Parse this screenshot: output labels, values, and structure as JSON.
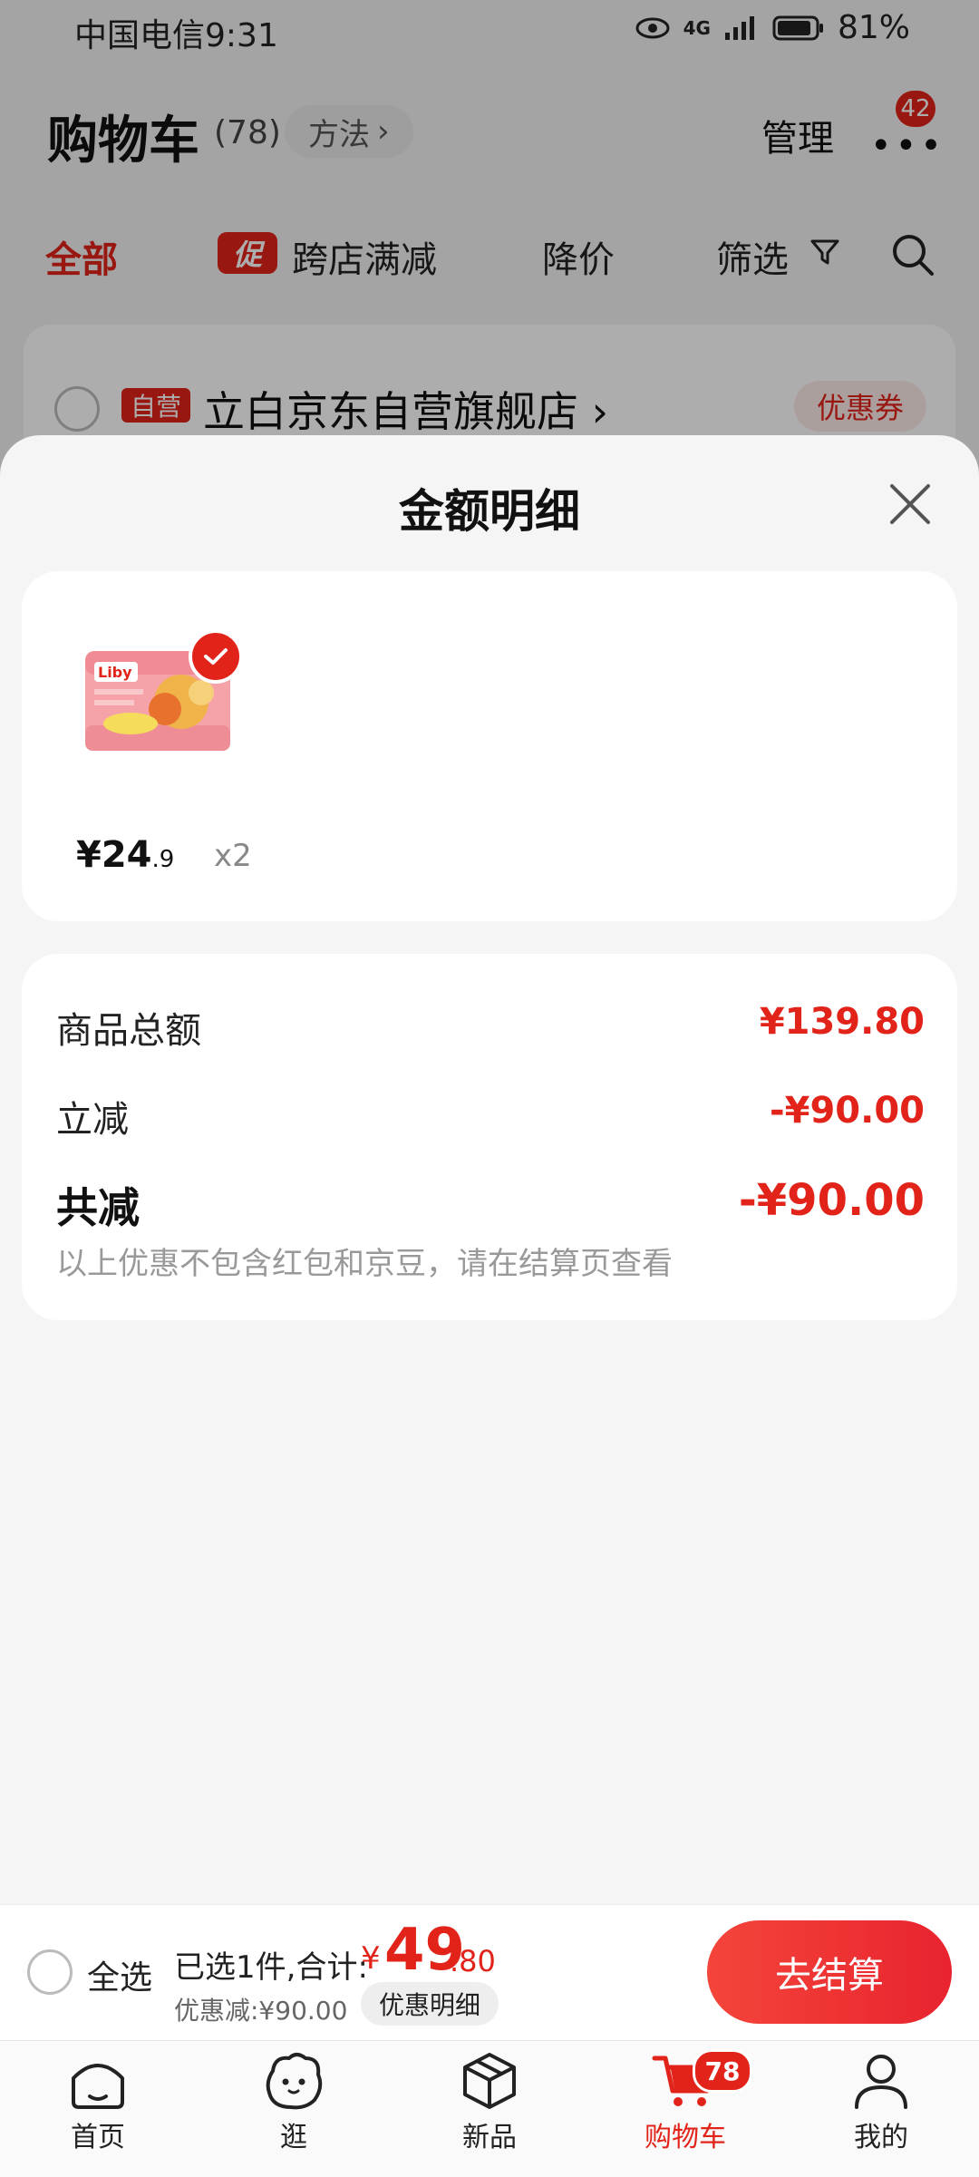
{
  "status_bar": {
    "carrier_time": "中国电信9:31",
    "network": "4G",
    "battery": "81%"
  },
  "cart_header": {
    "title": "购物车",
    "count": "(78)",
    "method_label": "方法",
    "manage_label": "管理",
    "message_badge": "42"
  },
  "filters": {
    "all": "全部",
    "promo_tag": "促",
    "cross_store": "跨店满减",
    "price_drop": "降价",
    "screen": "筛选"
  },
  "store": {
    "self_tag": "自营",
    "name": "立白京东自营旗舰店 ›",
    "coupon": "优惠券"
  },
  "sheet": {
    "title": "金额明细",
    "product": {
      "price_main": "¥24",
      "price_decimal": ".9",
      "quantity": "x2"
    },
    "rows": [
      {
        "label": "商品总额",
        "value": "¥139.80"
      },
      {
        "label": "立减",
        "value": "-¥90.00"
      }
    ],
    "total_label": "共减",
    "total_value": "-¥90.00",
    "note": "以上优惠不包含红包和京豆，请在结算页查看"
  },
  "checkout": {
    "select_all": "全选",
    "selected_text": "已选1件,合计:",
    "currency": "¥",
    "total_int": "49",
    "total_dec": ".80",
    "discount_text": "优惠减:¥90.00",
    "detail_chip": "优惠明细",
    "button": "去结算"
  },
  "tabbar": {
    "items": [
      {
        "label": "首页",
        "icon": "home-icon"
      },
      {
        "label": "逛",
        "icon": "face-icon"
      },
      {
        "label": "新品",
        "icon": "box-icon"
      },
      {
        "label": "购物车",
        "icon": "cart-icon"
      },
      {
        "label": "我的",
        "icon": "user-icon"
      }
    ],
    "cart_badge": "78"
  },
  "colors": {
    "accent": "#e2231a",
    "sheet_bg": "#f5f5f5"
  }
}
